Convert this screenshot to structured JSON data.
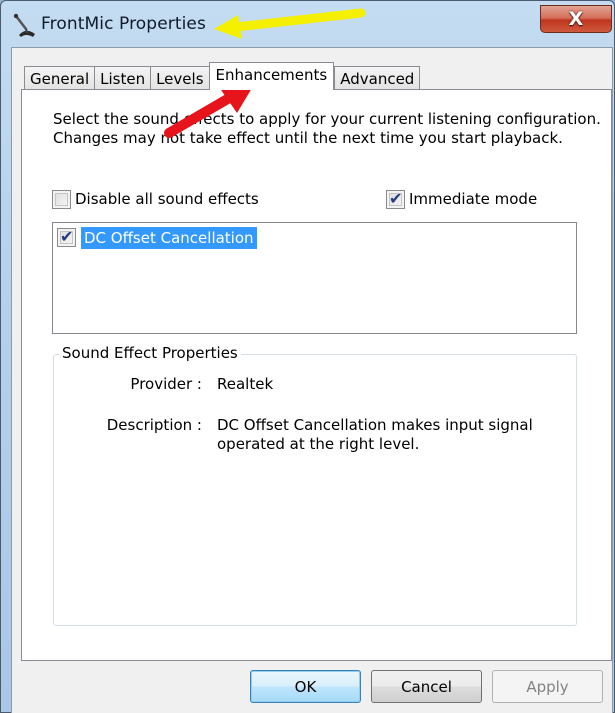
{
  "window": {
    "title": "FrontMic Properties",
    "app_icon": "microphone-icon",
    "close_glyph": "X",
    "close_icon": "close-icon"
  },
  "tabs": [
    {
      "label": "General",
      "active": false
    },
    {
      "label": "Listen",
      "active": false
    },
    {
      "label": "Levels",
      "active": false
    },
    {
      "label": "Enhancements",
      "active": true
    },
    {
      "label": "Advanced",
      "active": false
    }
  ],
  "enhancements": {
    "intro_line1": "Select the sound effects to apply for your current listening configuration.",
    "intro_line2": "Changes may not take effect until the next time you start playback.",
    "disable_all": {
      "label": "Disable all sound effects",
      "checked": false
    },
    "immediate_mode": {
      "label": "Immediate mode",
      "checked": true
    },
    "effects": [
      {
        "label": "DC Offset Cancellation",
        "checked": true,
        "selected": true
      }
    ],
    "properties": {
      "legend": "Sound Effect Properties",
      "provider_label": "Provider :",
      "provider_value": "Realtek",
      "description_label": "Description :",
      "description_line1": "DC Offset Cancellation makes input signal",
      "description_line2": "operated at the right level."
    }
  },
  "buttons": {
    "ok": "OK",
    "cancel": "Cancel",
    "apply": "Apply",
    "apply_enabled": false
  },
  "annotations": [
    {
      "type": "arrow",
      "color": "#f5f000",
      "points_to": "window title"
    },
    {
      "type": "arrow",
      "color": "#e8141b",
      "points_to": "Enhancements tab"
    }
  ],
  "colors": {
    "selection": "#3399ff",
    "check_mark": "#233d80",
    "close_button": "#c0361e",
    "default_button_border": "#3c7fb1"
  }
}
